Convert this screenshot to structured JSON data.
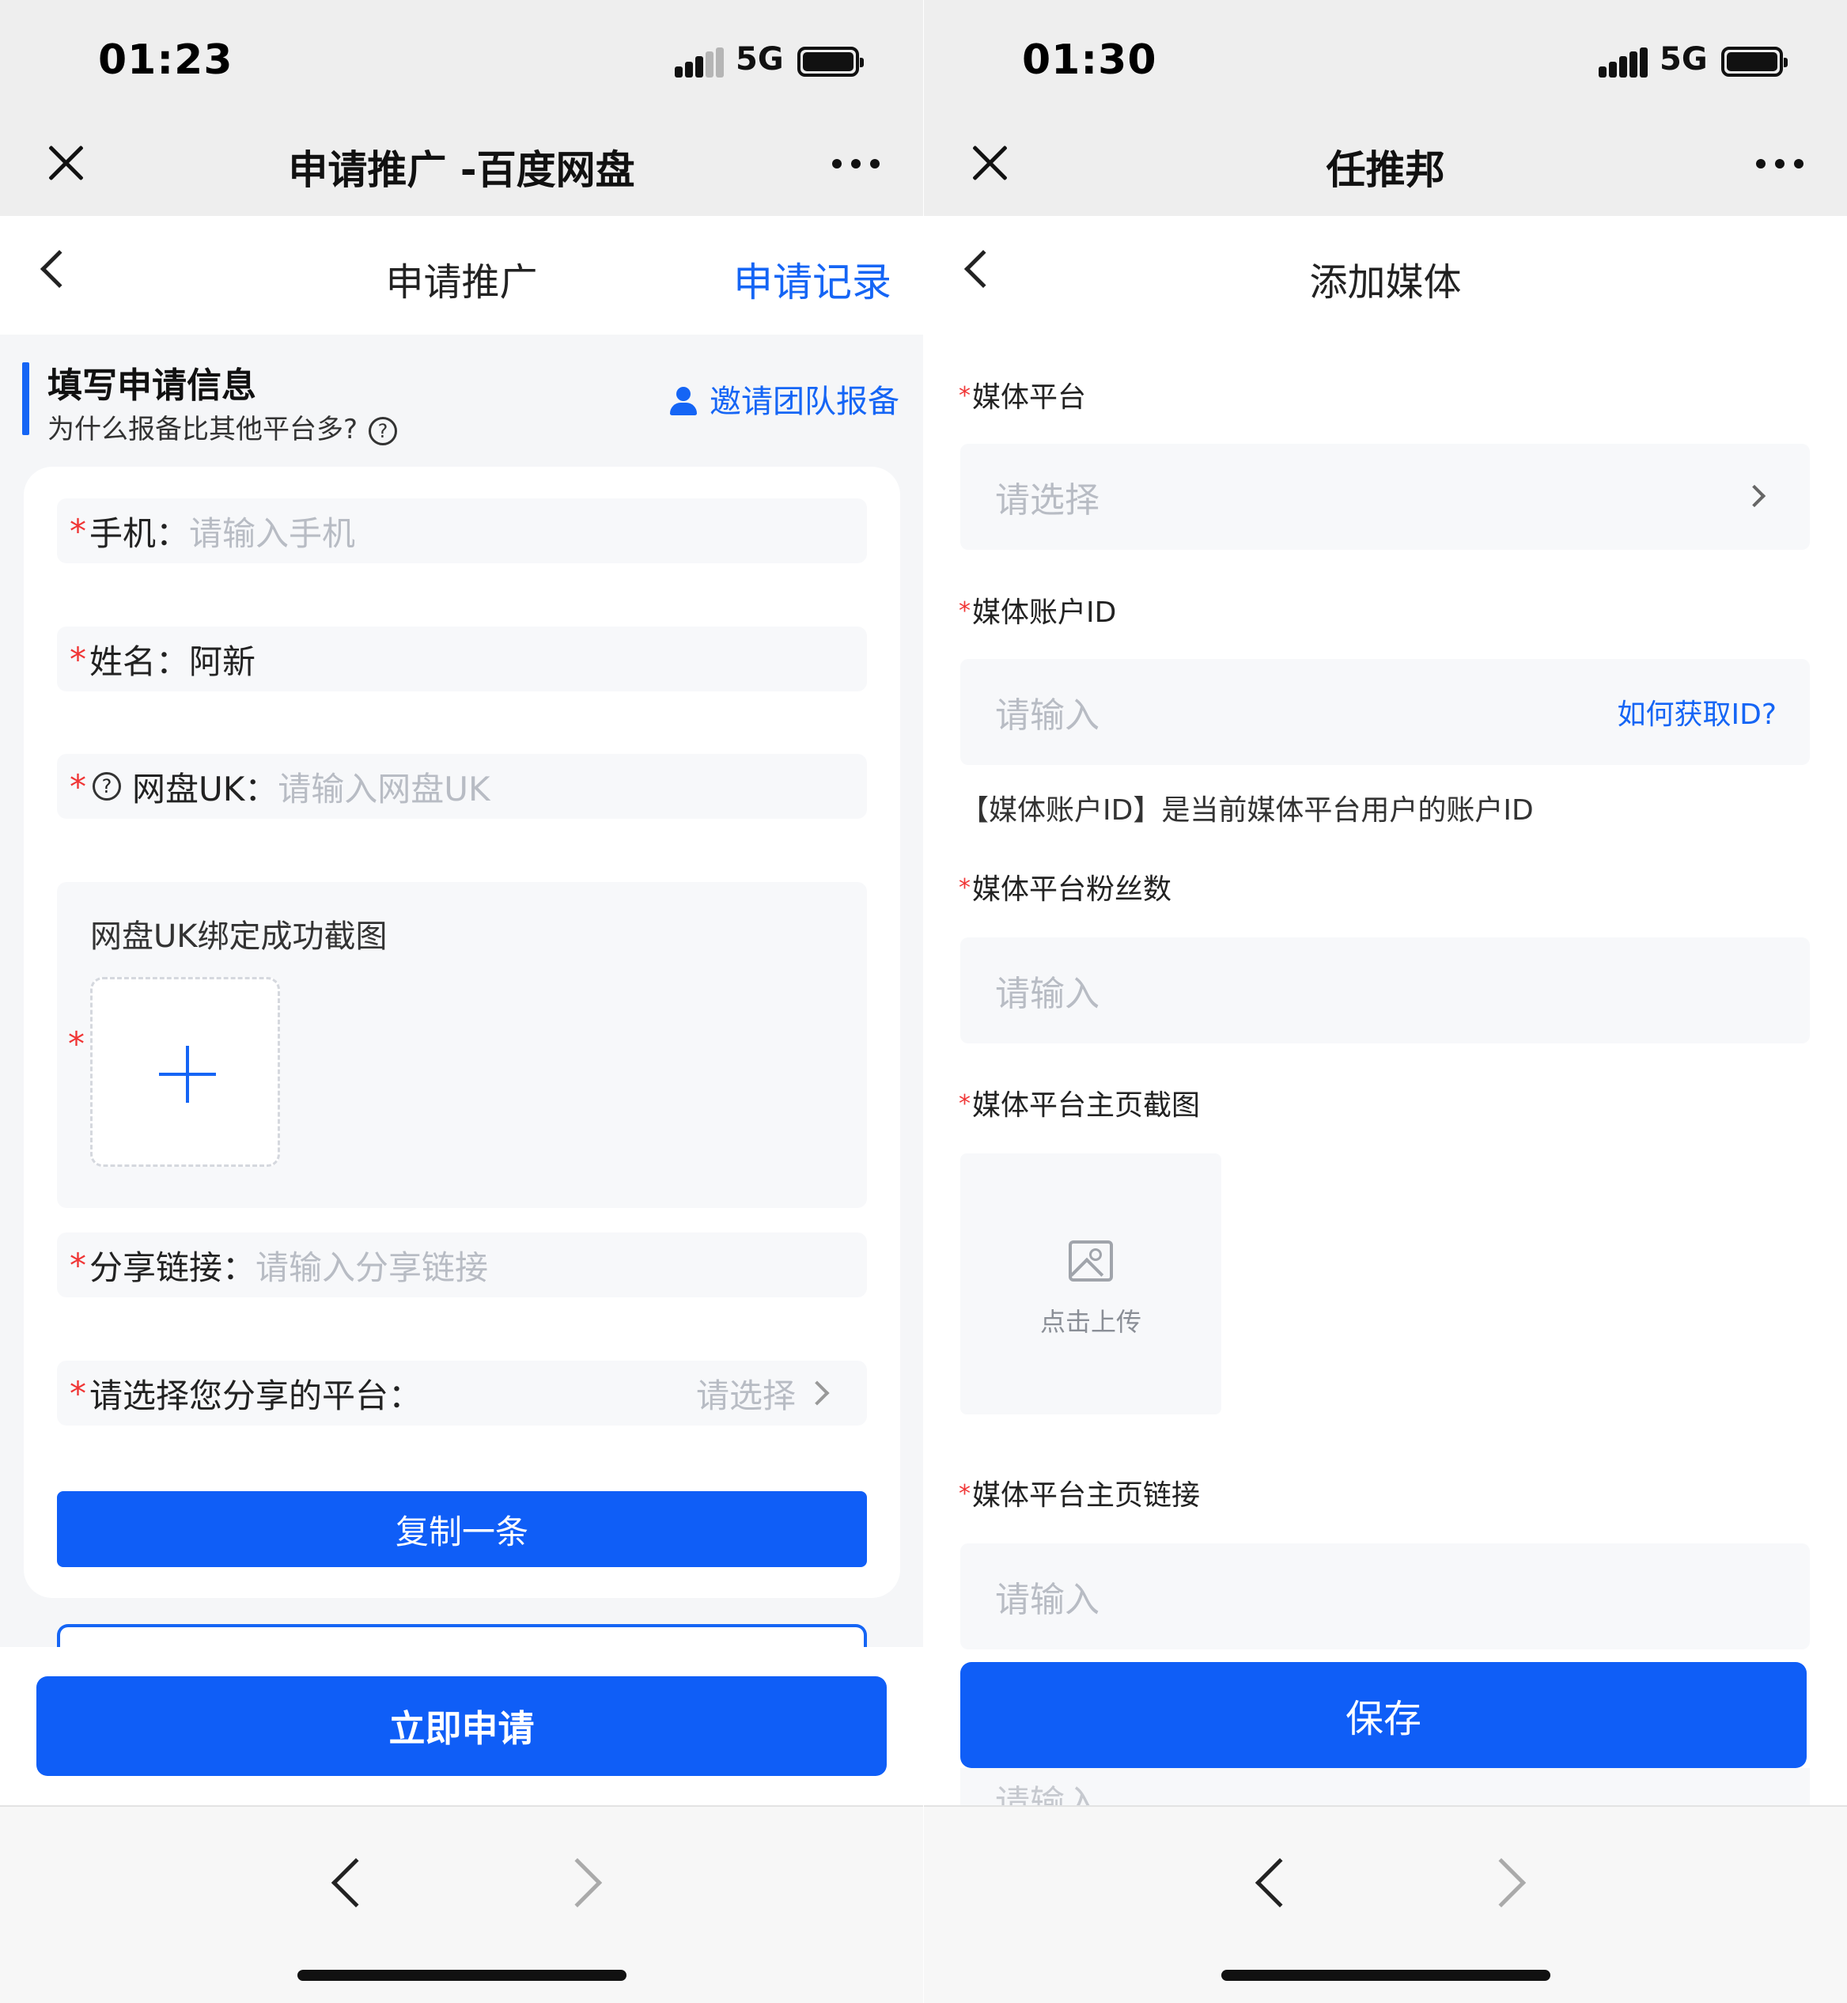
{
  "left": {
    "status": {
      "time": "01:23",
      "network": "5G"
    },
    "titlebar": {
      "title": "申请推广 -百度网盘"
    },
    "nav": {
      "title": "申请推广",
      "link": "申请记录"
    },
    "section": {
      "title": "填写申请信息",
      "subtitle": "为什么报备比其他平台多?",
      "help_glyph": "?",
      "invite": "邀请团队报备"
    },
    "form": {
      "required_mark": "*",
      "phone": {
        "label": "手机：",
        "placeholder": "请输入手机"
      },
      "name": {
        "label": "姓名：",
        "value": "阿新"
      },
      "uk": {
        "label": "网盘UK：",
        "placeholder": "请输入网盘UK",
        "help_glyph": "?"
      },
      "screenshot": {
        "label": "网盘UK绑定成功截图"
      },
      "share_link": {
        "label": "分享链接：",
        "placeholder": "请输入分享链接"
      },
      "platform": {
        "label": "请选择您分享的平台：",
        "placeholder": "请选择"
      },
      "copy_button": "复制一条"
    },
    "submit_button": "立即申请"
  },
  "right": {
    "status": {
      "time": "01:30",
      "network": "5G"
    },
    "titlebar": {
      "title": "任推邦"
    },
    "nav": {
      "title": "添加媒体"
    },
    "form": {
      "required_mark": "*",
      "media_platform": {
        "label": "媒体平台",
        "placeholder": "请选择"
      },
      "account_id": {
        "label": "媒体账户ID",
        "placeholder": "请输入",
        "help_link": "如何获取ID?",
        "hint": "【媒体账户ID】是当前媒体平台用户的账户ID"
      },
      "fans": {
        "label": "媒体平台粉丝数",
        "placeholder": "请输入"
      },
      "homepage_shot": {
        "label": "媒体平台主页截图",
        "upload_caption": "点击上传"
      },
      "homepage_link": {
        "label": "媒体平台主页链接",
        "placeholder": "请输入"
      },
      "next_placeholder": "请输入"
    },
    "save_button": "保存"
  },
  "icons": [
    "close-icon",
    "more-icon",
    "back-icon",
    "help-icon",
    "person-icon",
    "plus-icon",
    "chevron-right-icon",
    "image-icon",
    "browser-back-icon",
    "browser-forward-icon"
  ],
  "colors": {
    "primary": "#0f5ef7",
    "link": "#1565f5",
    "required": "#f03535",
    "placeholder": "#b8bcc4"
  }
}
